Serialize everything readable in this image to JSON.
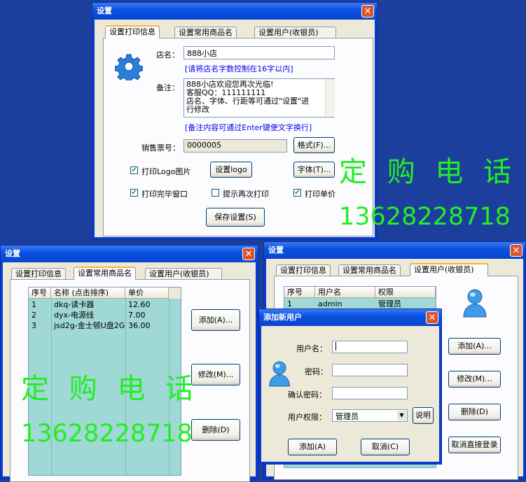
{
  "win1": {
    "title": "设置",
    "tabs": [
      "设置打印信息",
      "设置常用商品名",
      "设置用户(收银员)"
    ],
    "shop_name_label": "店名：",
    "shop_name_value": "888小店",
    "shop_name_hint": "[请将店名字数控制在16字以内]",
    "remark_label": "备注：",
    "remark_lines": [
      "888小店欢迎您再次光临!",
      "客服QQ：111111111",
      "店名、字体、行距等可通过\"设置\"进",
      "行修改"
    ],
    "remark_hint": "[备注内容可通过Enter键使文字换行]",
    "receipt_label": "销售票号：",
    "receipt_value": "0000005",
    "format_button": "格式(F)...",
    "font_button": "字体(T)...",
    "print_logo_label": "打印Logo图片",
    "set_logo_button": "设置logo",
    "print_close_label": "打印完毕窗口",
    "reprint_prompt_label": "提示再次打印",
    "print_unit_price_label": "打印单价",
    "save_button": "保存设置(S)"
  },
  "win2": {
    "title": "设置",
    "tabs": [
      "设置打印信息",
      "设置常用商品名",
      "设置用户(收银员)"
    ],
    "columns": [
      "序号",
      "名称 (点击排序)",
      "单价"
    ],
    "rows": [
      [
        "1",
        "dkq-读卡器",
        "12.60"
      ],
      [
        "2",
        "dyx-电源线",
        "7.00"
      ],
      [
        "3",
        "jsd2g-金士顿U盘2G",
        "36.00"
      ]
    ],
    "add_button": "添加(A)...",
    "edit_button": "修改(M)...",
    "delete_button": "删除(D)"
  },
  "win3": {
    "title": "设置",
    "tabs": [
      "设置打印信息",
      "设置常用商品名",
      "设置用户(收银员)"
    ],
    "columns": [
      "序号",
      "用户名",
      "权限"
    ],
    "rows": [
      [
        "1",
        "admin",
        "管理员"
      ]
    ],
    "add_button": "添加(A)...",
    "edit_button": "修改(M)...",
    "delete_button": "删除(D)",
    "cancel_login_button": "取消直接登录"
  },
  "dialog": {
    "title": "添加新用户",
    "username_label": "用户名：",
    "password_label": "密码：",
    "confirm_label": "确认密码：",
    "role_label": "用户权限：",
    "role_value": "管理员",
    "explain_button": "说明",
    "add_button": "添加(A)",
    "cancel_button": "取消(C)"
  },
  "watermark": {
    "text1": "定 购 电 话",
    "phone1": "13628228718",
    "text2": "定 购 电 话",
    "phone2": "13628228718"
  },
  "colors": {
    "title_blue": "#0a52e0",
    "face": "#ece9d8",
    "grid_bg": "#9fd8d5",
    "hint_blue": "#0000ee",
    "watermark_green": "#22ee22"
  }
}
